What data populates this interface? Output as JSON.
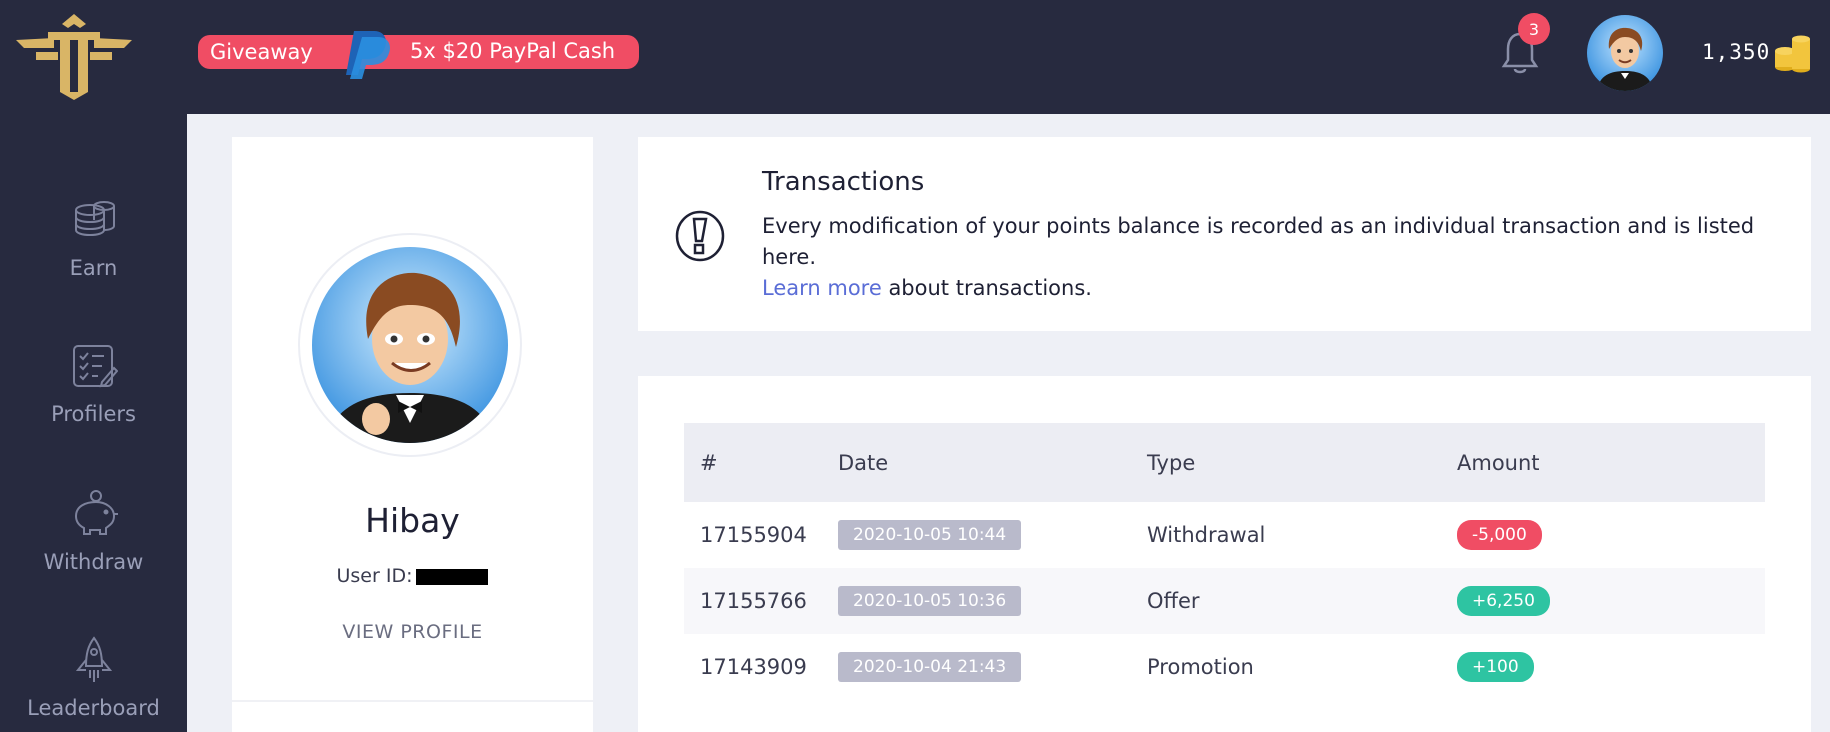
{
  "promo": {
    "label": "Giveaway",
    "prize": "5x $20 PayPal Cash"
  },
  "header": {
    "notification_count": "3",
    "balance": "1,350"
  },
  "sidebar": {
    "items": [
      {
        "label": "Earn",
        "icon": "coins-stack-icon"
      },
      {
        "label": "Profilers",
        "icon": "checklist-icon"
      },
      {
        "label": "Withdraw",
        "icon": "piggy-bank-icon"
      },
      {
        "label": "Leaderboard",
        "icon": "rocket-icon"
      }
    ]
  },
  "profile": {
    "name": "Hibay",
    "user_id_label": "User ID:",
    "view_profile": "VIEW PROFILE"
  },
  "info": {
    "title": "Transactions",
    "text": "Every modification of your points balance is recorded as an individual transaction and is listed here.",
    "link": "Learn more",
    "link_suffix": " about transactions."
  },
  "table": {
    "headers": [
      "#",
      "Date",
      "Type",
      "Amount"
    ],
    "rows": [
      {
        "id": "17155904",
        "date": "2020-10-05 10:44",
        "type": "Withdrawal",
        "amount": "-5,000"
      },
      {
        "id": "17155766",
        "date": "2020-10-05 10:36",
        "type": "Offer",
        "amount": "+6,250"
      },
      {
        "id": "17143909",
        "date": "2020-10-04 21:43",
        "type": "Promotion",
        "amount": "+100"
      }
    ]
  },
  "colors": {
    "topbar": "#272a3f",
    "accent_red": "#f04d64",
    "accent_green": "#2ec4a2",
    "link": "#5a6dd6",
    "logo_gold": "#d9b566"
  }
}
